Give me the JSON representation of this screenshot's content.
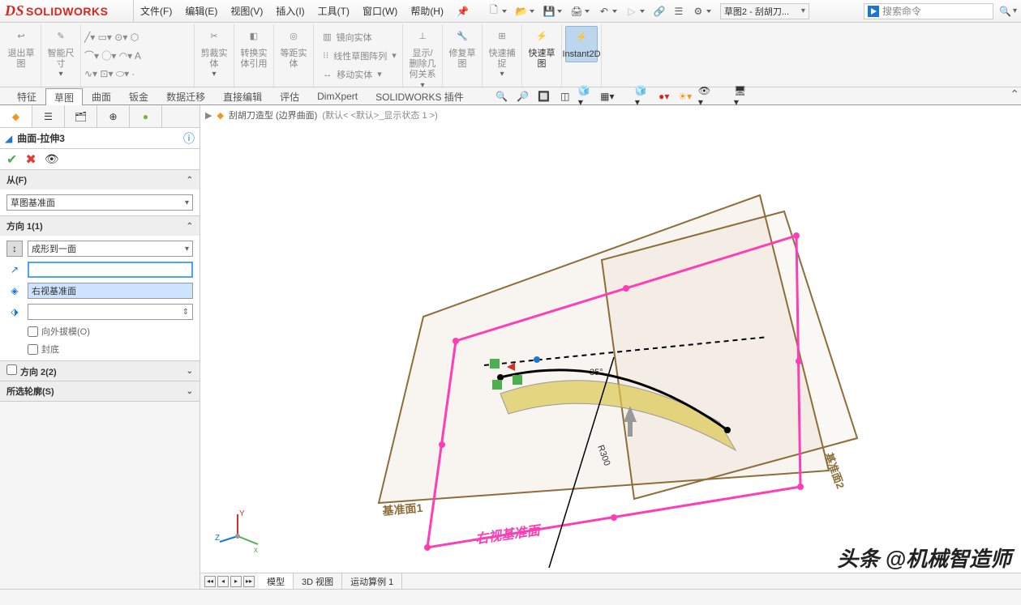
{
  "app": {
    "name": "SOLIDWORKS"
  },
  "menu": [
    "文件(F)",
    "编辑(E)",
    "视图(V)",
    "插入(I)",
    "工具(T)",
    "窗口(W)",
    "帮助(H)"
  ],
  "doc_combo": "草图2 - 刮胡刀...",
  "search_placeholder": "搜索命令",
  "ribbon": {
    "exit_sketch": "退出草图",
    "smart_dim": "智能尺寸",
    "trim": "剪裁实体",
    "convert": "转换实体引用",
    "offset": "等距实体",
    "mirror": "镜向实体",
    "pattern": "线性草图阵列",
    "move": "移动实体",
    "show_rel": "显示/删除几何关系",
    "repair": "修复草图",
    "quick_snap": "快速捕捉",
    "rapid_sketch": "快速草图",
    "instant2d": "Instant2D"
  },
  "cmd_tabs": [
    "特征",
    "草图",
    "曲面",
    "钣金",
    "数据迁移",
    "直接编辑",
    "评估",
    "DimXpert",
    "SOLIDWORKS 插件"
  ],
  "active_cmd_tab": 1,
  "breadcrumb": {
    "part": "刮胡刀造型  (边界曲面)",
    "config": "(默认< <默认>_显示状态 1 >)"
  },
  "feature": {
    "name": "曲面-拉伸3",
    "sec_from": "从(F)",
    "from_option": "草图基准面",
    "sec_dir1": "方向 1(1)",
    "dir1_option": "成形到一面",
    "dir1_face": "右视基准面",
    "draft_out": "向外拔模(O)",
    "cap_end": "封底",
    "sec_dir2": "方向 2(2)",
    "sec_contour": "所选轮廓(S)"
  },
  "viewport_labels": {
    "plane1": "基准面1",
    "plane2": "基准面2",
    "right_plane": "右视基准面",
    "dim_angle": "35°",
    "dim_r": "R300"
  },
  "bottom_tabs": [
    "模型",
    "3D 视图",
    "运动算例 1"
  ],
  "watermark": "头条 @机械智造师"
}
